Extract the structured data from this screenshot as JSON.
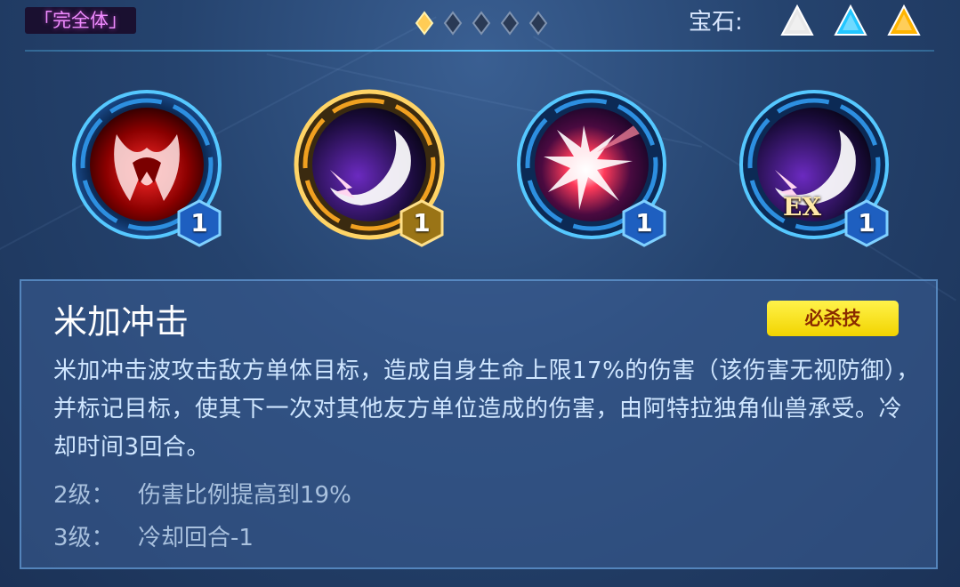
{
  "header": {
    "form_tag": "「完全体」",
    "pager": {
      "count": 5,
      "active": 0
    },
    "gem_label": "宝石:",
    "gems": [
      {
        "name": "white-gem-icon",
        "color": "#e8e8e8"
      },
      {
        "name": "blue-gem-icon",
        "color": "#22c6ff"
      },
      {
        "name": "gold-gem-icon",
        "color": "#ffb400"
      }
    ]
  },
  "skills": [
    {
      "name": "skill-claw",
      "level": "1",
      "selected": false
    },
    {
      "name": "skill-mega-strike",
      "level": "1",
      "selected": true
    },
    {
      "name": "skill-burst",
      "level": "1",
      "selected": false
    },
    {
      "name": "skill-mega-strike-ex",
      "level": "1",
      "selected": false,
      "badge_text": "EX"
    }
  ],
  "detail": {
    "title": "米加冲击",
    "type": "必杀技",
    "description": "米加冲击波攻击敌方单体目标，造成自身生命上限17%的伤害（该伤害无视防御），并标记目标，使其下一次对其他友方单位造成的伤害，由阿特拉独角仙兽承受。冷却时间3回合。",
    "upgrades": [
      {
        "level": "2级：",
        "text": "伤害比例提高到19%"
      },
      {
        "level": "3级：",
        "text": "冷却回合-1"
      }
    ]
  },
  "colors": {
    "accent_blue": "#3fb4ff",
    "accent_gold": "#f5c542",
    "type_badge": "#fff24a"
  }
}
